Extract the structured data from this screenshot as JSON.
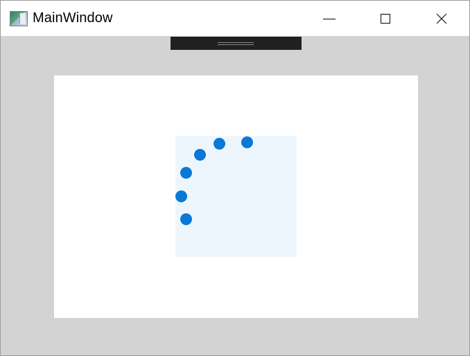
{
  "window": {
    "title": "MainWindow",
    "icon": "app-window-icon"
  },
  "caption_buttons": {
    "minimize_icon": "minimize-icon",
    "maximize_icon": "maximize-icon",
    "close_icon": "close-icon"
  },
  "drag_handle": {
    "icon": "grip-lines-icon"
  },
  "loading_indicator": {
    "dot_count": 6,
    "dot_color": "#0a78d7",
    "panel_color": "#eef6fd"
  },
  "colors": {
    "client_background": "#d3d3d3",
    "canvas_background": "#ffffff",
    "titlebar_background": "#ffffff",
    "handle_background": "#202020"
  }
}
